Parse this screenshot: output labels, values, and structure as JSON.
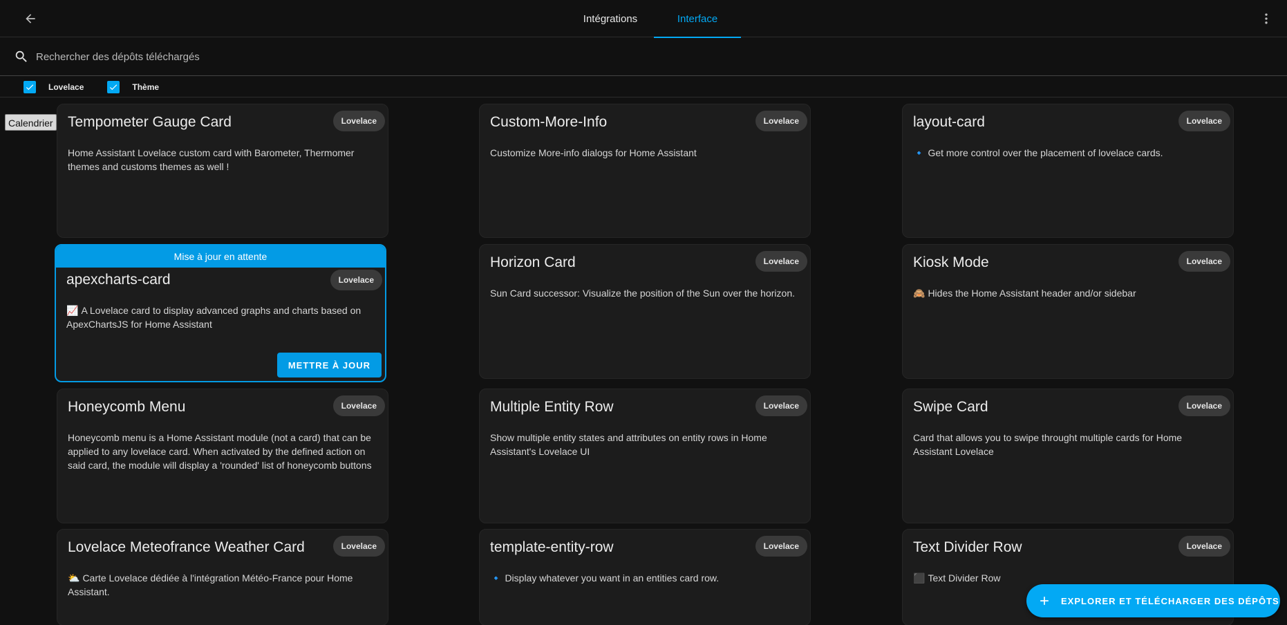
{
  "tabs": [
    {
      "label": "Intégrations"
    },
    {
      "label": "Interface"
    }
  ],
  "search": {
    "placeholder": "Rechercher des dépôts téléchargés",
    "value": ""
  },
  "filters": [
    {
      "label": "Lovelace",
      "checked": true
    },
    {
      "label": "Thème",
      "checked": true
    }
  ],
  "tooltip": {
    "text": "Calendrier"
  },
  "cards": [
    {
      "title": "Tempometer Gauge Card",
      "badge": "Lovelace",
      "description": "Home Assistant Lovelace custom card with Barometer, Thermomer themes and customs themes as well !"
    },
    {
      "title": "Custom-More-Info",
      "badge": "Lovelace",
      "description": "Customize More-info dialogs for Home Assistant"
    },
    {
      "title": "layout-card",
      "badge": "Lovelace",
      "emoji": "🔹",
      "description": "Get more control over the placement of lovelace cards."
    },
    {
      "title": "apexcharts-card",
      "badge": "Lovelace",
      "banner": "Mise à jour en attente",
      "emoji": "📈",
      "description": "A Lovelace card to display advanced graphs and charts based on ApexChartsJS for Home Assistant",
      "action": "METTRE À JOUR"
    },
    {
      "title": "Horizon Card",
      "badge": "Lovelace",
      "description": "Sun Card successor: Visualize the position of the Sun over the horizon."
    },
    {
      "title": "Kiosk Mode",
      "badge": "Lovelace",
      "emoji": "🙈",
      "description": "Hides the Home Assistant header and/or sidebar"
    },
    {
      "title": "Honeycomb Menu",
      "badge": "Lovelace",
      "description": "Honeycomb menu is a Home Assistant module (not a card) that can be applied to any lovelace card. When activated by the defined action on said card, the module will display a 'rounded' list of honeycomb buttons"
    },
    {
      "title": "Multiple Entity Row",
      "badge": "Lovelace",
      "description": "Show multiple entity states and attributes on entity rows in Home Assistant's Lovelace UI"
    },
    {
      "title": "Swipe Card",
      "badge": "Lovelace",
      "description": "Card that allows you to swipe throught multiple cards for Home Assistant Lovelace"
    },
    {
      "title": "Lovelace Meteofrance Weather Card",
      "badge": "Lovelace",
      "emoji": "⛅",
      "description": "Carte Lovelace dédiée à l'intégration Météo-France pour Home Assistant."
    },
    {
      "title": "template-entity-row",
      "badge": "Lovelace",
      "emoji": "🔹",
      "description": "Display whatever you want in an entities card row."
    },
    {
      "title": "Text Divider Row",
      "badge": "Lovelace",
      "emoji": "⬛",
      "description": "Text Divider Row"
    }
  ],
  "fab": {
    "label": "EXPLORER ET TÉLÉCHARGER DES DÉPÔTS"
  },
  "colors": {
    "accent": "#03a9f4",
    "pending": "#039be5",
    "card": "#1c1c1c",
    "background": "#111111"
  }
}
